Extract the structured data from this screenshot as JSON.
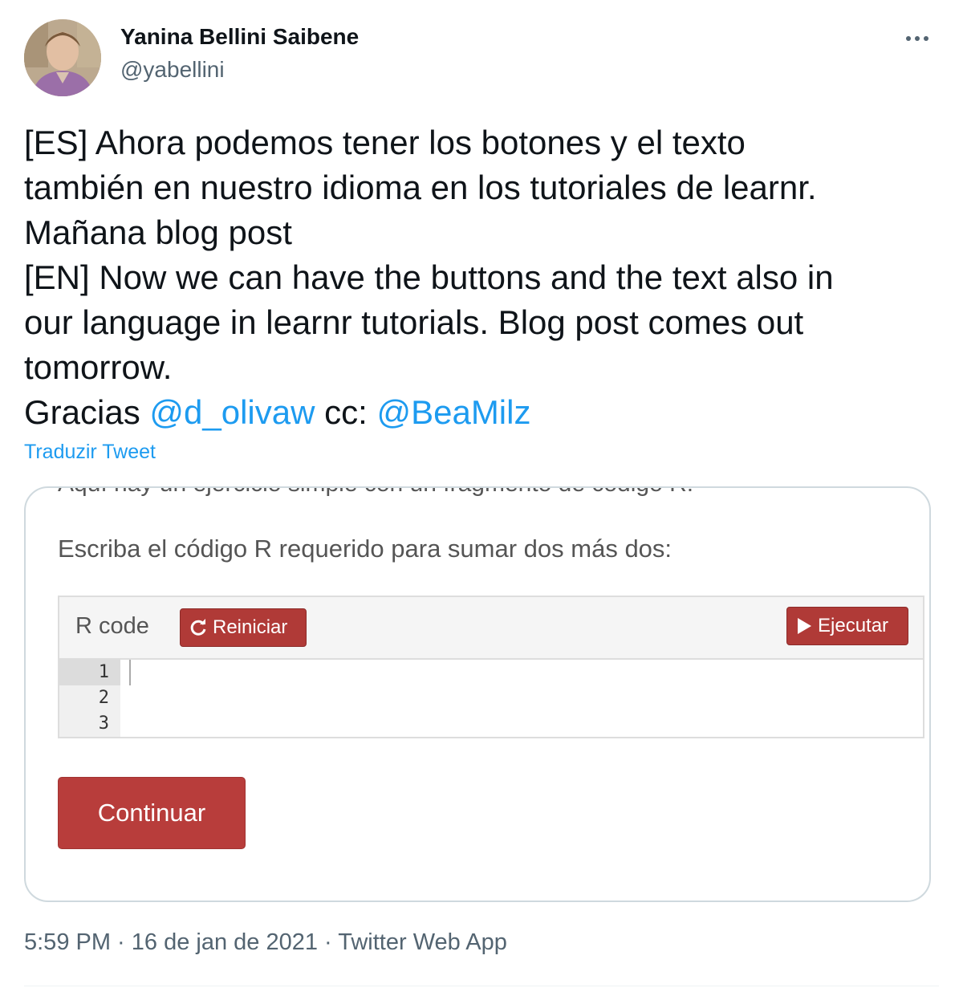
{
  "author": {
    "display_name": "Yanina Bellini Saibene",
    "handle": "@yabellini"
  },
  "tweet": {
    "lines": [
      "[ES] Ahora podemos tener los botones y el texto",
      "también en nuestro idioma en los tutoriales de learnr.",
      "Mañana blog post",
      "[EN] Now we can have the buttons and the text also in",
      "our language in learnr tutorials. Blog post comes out",
      "tomorrow."
    ],
    "gracias_prefix": "Gracias ",
    "mention_1": "@d_olivaw",
    "cc_text": " cc: ",
    "mention_2": "@BeaMilz",
    "translate_link": "Traduzir Tweet"
  },
  "media": {
    "cut_text": "Aquí hay un ejercicio simple con un fragmento de código R:",
    "prompt": "Escriba el código R requerido para sumar dos más dos:",
    "code_label": "R code",
    "reset_label": "Reiniciar",
    "run_label": "Ejecutar",
    "line_numbers": [
      "1",
      "2",
      "3"
    ],
    "continue_label": "Continuar"
  },
  "meta": {
    "time": "5:59 PM",
    "sep1": " · ",
    "date": "16 de jan de 2021",
    "sep2": " · ",
    "source": "Twitter Web App"
  },
  "colors": {
    "link": "#1d9bf0",
    "button_red": "#b83d3b",
    "secondary_text": "#536471"
  },
  "icons": {
    "more": "more-horizontal-icon",
    "reset": "refresh-icon",
    "run": "play-icon"
  }
}
